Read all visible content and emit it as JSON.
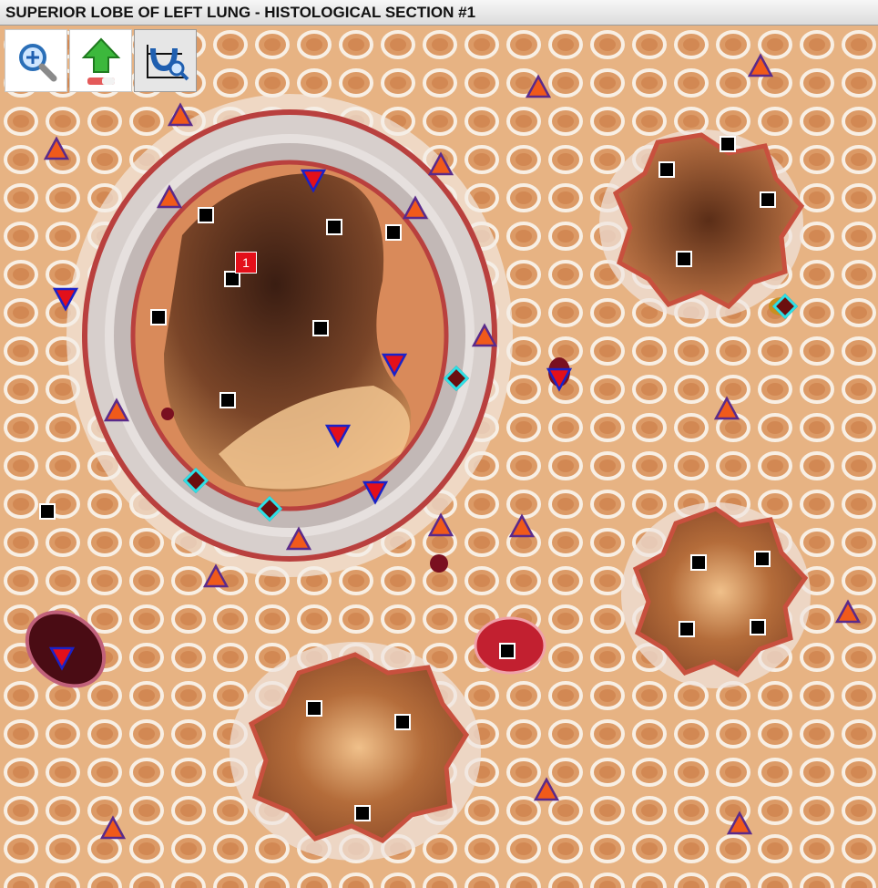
{
  "window": {
    "title": "SUPERIOR LOBE OF LEFT LUNG - HISTOLOGICAL SECTION #1"
  },
  "toolbar": {
    "tools": [
      {
        "icon": "zoom-in-icon"
      },
      {
        "icon": "upload-arrow-icon"
      },
      {
        "icon": "lasso-magnify-icon"
      }
    ]
  },
  "annotations": {
    "selected_label": "1",
    "marker_types": [
      "square",
      "triangle-up-orange",
      "triangle-down-red",
      "diamond-dark-red-cyan"
    ]
  },
  "colors": {
    "square": "#000000",
    "triangle_up_fill": "#f05a1a",
    "triangle_up_stroke": "#5a2a8a",
    "triangle_down_fill": "#e3101a",
    "triangle_down_stroke": "#1a22c8",
    "diamond_fill": "#6b0f0f",
    "diamond_stroke": "#2ee0e6",
    "badge": "#e3101a"
  }
}
